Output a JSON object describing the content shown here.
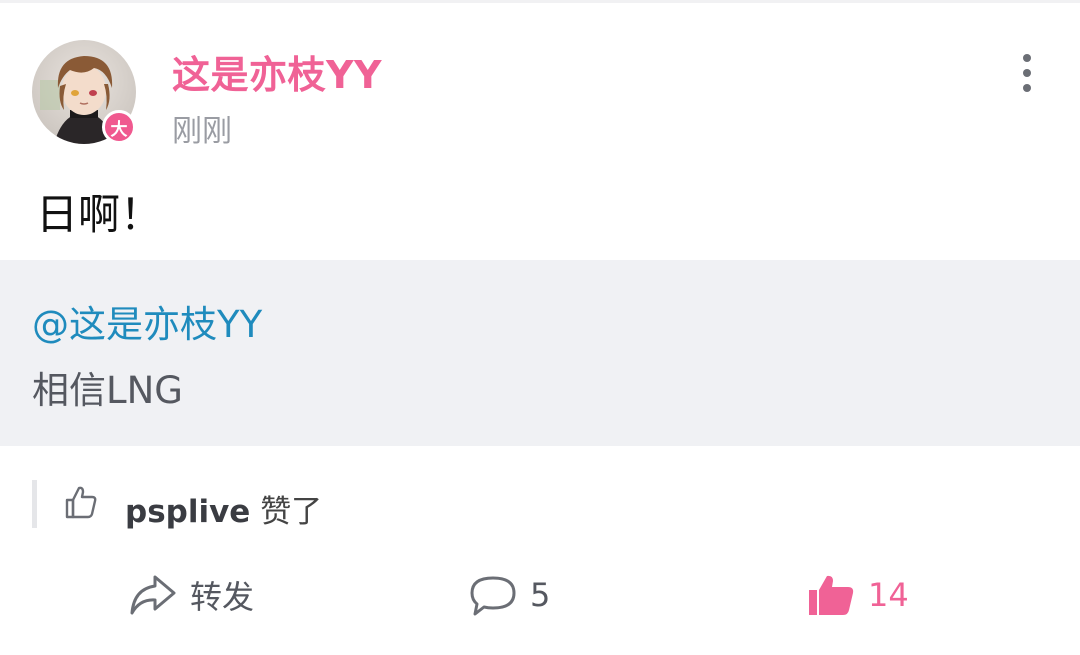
{
  "post": {
    "username": "这是亦枝YY",
    "timestamp": "刚刚",
    "badge": "大",
    "content": "日啊！",
    "avatar_icon": "anime-avatar"
  },
  "quoted": {
    "mention": "@这是亦枝YY",
    "text": "相信LNG"
  },
  "liked_by": {
    "user": "psplive",
    "suffix": "赞了"
  },
  "actions": {
    "repost_label": "转发",
    "comment_count": "5",
    "like_count": "14"
  },
  "colors": {
    "accent_pink": "#f06296",
    "mention_blue": "#1f8bbd",
    "quote_bg": "#f0f1f4"
  }
}
